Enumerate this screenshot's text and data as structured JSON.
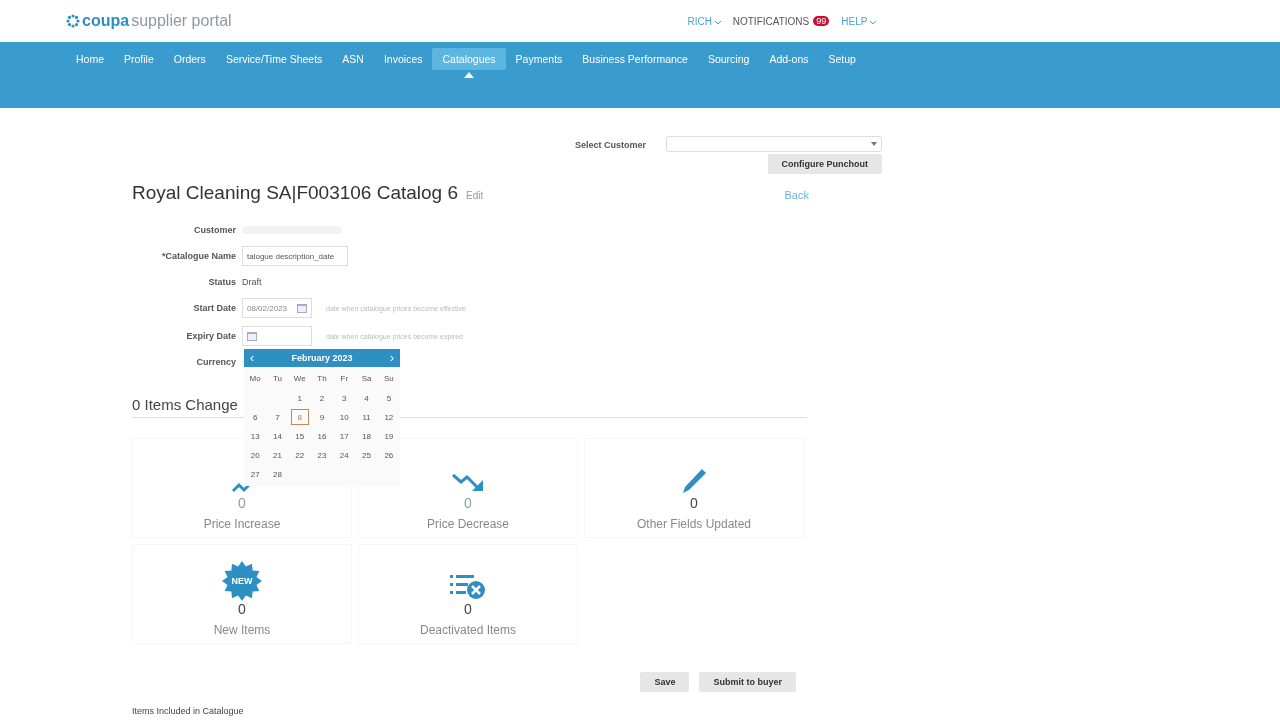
{
  "header": {
    "logo_brand": "coupa",
    "logo_product": "supplier portal",
    "user_menu": "RICH",
    "notifications": {
      "label": "NOTIFICATIONS",
      "count": "99"
    },
    "help_menu": "HELP"
  },
  "nav": [
    {
      "label": "Home",
      "selected": false
    },
    {
      "label": "Profile",
      "selected": false
    },
    {
      "label": "Orders",
      "selected": false
    },
    {
      "label": "Service/Time Sheets",
      "selected": false
    },
    {
      "label": "ASN",
      "selected": false
    },
    {
      "label": "Invoices",
      "selected": false
    },
    {
      "label": "Catalogues",
      "selected": true
    },
    {
      "label": "Payments",
      "selected": false
    },
    {
      "label": "Business Performance",
      "selected": false
    },
    {
      "label": "Sourcing",
      "selected": false
    },
    {
      "label": "Add-ons",
      "selected": false
    },
    {
      "label": "Setup",
      "selected": false
    }
  ],
  "customer_select": {
    "label": "Select Customer",
    "button": "Configure Punchout"
  },
  "title": "Royal Cleaning SA|F003106 Catalog 6",
  "edit_link": "Edit",
  "back_link": "Back",
  "form": [
    {
      "kind": "blurred",
      "label": "Customer"
    },
    {
      "kind": "input",
      "required_mark": "*",
      "label": "Catalogue Name",
      "value": "talogue description_date"
    },
    {
      "kind": "text",
      "label": "Status",
      "value": "Draft"
    },
    {
      "kind": "date",
      "label": "Start Date",
      "value": "08/02/2023",
      "hint": "date when catalogue prices become effective"
    },
    {
      "kind": "date",
      "label": "Expiry Date",
      "hint": "date when catalogue prices become expired"
    },
    {
      "kind": "blurred",
      "label": "Currency"
    }
  ],
  "calendar": {
    "prev": "‹",
    "month": "February 2023",
    "next": "›",
    "weekdays": [
      "Mo",
      "Tu",
      "We",
      "Th",
      "Fr",
      "Sa",
      "Su"
    ],
    "weeks": [
      [
        {
          "kind": "blank"
        },
        {
          "kind": "blank"
        },
        {
          "kind": "day",
          "label": "1",
          "selected": false
        },
        {
          "kind": "day",
          "label": "2",
          "selected": false
        },
        {
          "kind": "day",
          "label": "3",
          "selected": false
        },
        {
          "kind": "day",
          "label": "4",
          "selected": false
        },
        {
          "kind": "day",
          "label": "5",
          "selected": false
        }
      ],
      [
        {
          "kind": "day",
          "label": "6",
          "selected": false
        },
        {
          "kind": "day",
          "label": "7",
          "selected": false
        },
        {
          "kind": "day",
          "label": "8",
          "selected": true
        },
        {
          "kind": "day",
          "label": "9",
          "selected": false
        },
        {
          "kind": "day",
          "label": "10",
          "selected": false
        },
        {
          "kind": "day",
          "label": "11",
          "selected": false
        },
        {
          "kind": "day",
          "label": "12",
          "selected": false
        }
      ],
      [
        {
          "kind": "day",
          "label": "13",
          "selected": false
        },
        {
          "kind": "day",
          "label": "14",
          "selected": false
        },
        {
          "kind": "day",
          "label": "15",
          "selected": false
        },
        {
          "kind": "day",
          "label": "16",
          "selected": false
        },
        {
          "kind": "day",
          "label": "17",
          "selected": false
        },
        {
          "kind": "day",
          "label": "18",
          "selected": false
        },
        {
          "kind": "day",
          "label": "19",
          "selected": false
        }
      ],
      [
        {
          "kind": "day",
          "label": "20",
          "selected": false
        },
        {
          "kind": "day",
          "label": "21",
          "selected": false
        },
        {
          "kind": "day",
          "label": "22",
          "selected": false
        },
        {
          "kind": "day",
          "label": "23",
          "selected": false
        },
        {
          "kind": "day",
          "label": "24",
          "selected": false
        },
        {
          "kind": "day",
          "label": "25",
          "selected": false
        },
        {
          "kind": "day",
          "label": "26",
          "selected": false
        }
      ],
      [
        {
          "kind": "day",
          "label": "27",
          "selected": false
        },
        {
          "kind": "day",
          "label": "28",
          "selected": false
        }
      ]
    ]
  },
  "items_changed_heading": "0 Items Change",
  "stats": [
    {
      "kind": "increase",
      "count": "0",
      "label": "Price Increase"
    },
    {
      "kind": "decrease",
      "count": "0",
      "label": "Price Decrease"
    },
    {
      "kind": "edit",
      "count": "0",
      "label": "Other Fields Updated"
    },
    {
      "kind": "new",
      "count": "0",
      "label": "New Items",
      "badge": "NEW"
    },
    {
      "kind": "deactivated",
      "count": "0",
      "label": "Deactivated Items"
    }
  ],
  "actions": [
    "Save",
    "Submit to buyer"
  ],
  "footer_heading": "Items Included in Catalogue"
}
